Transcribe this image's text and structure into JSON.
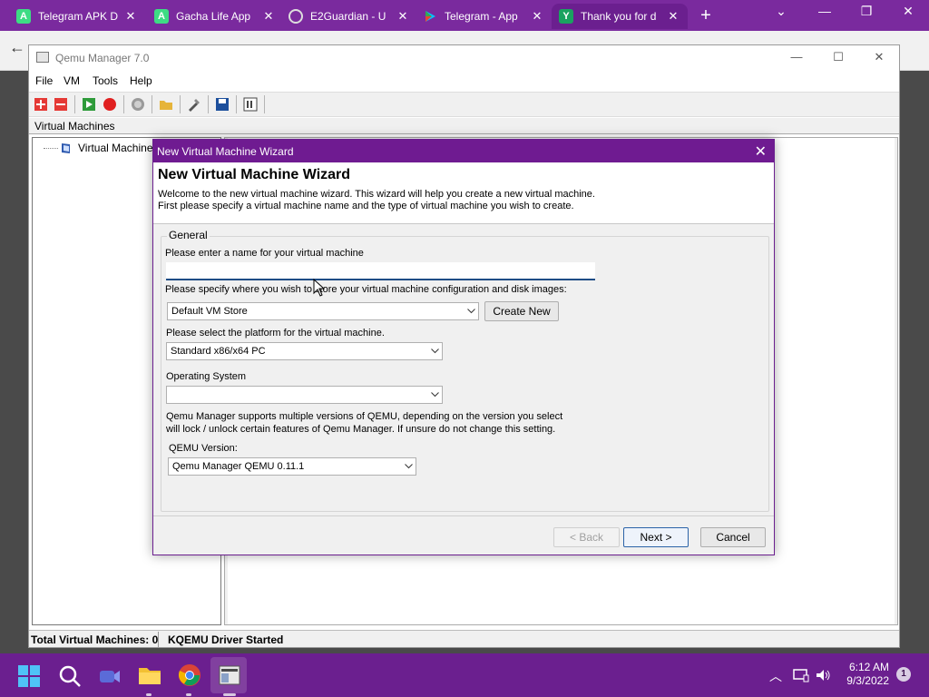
{
  "browser": {
    "tabs": [
      {
        "title": "Telegram APK D",
        "icon": "android-icon"
      },
      {
        "title": "Gacha Life App",
        "icon": "android-icon"
      },
      {
        "title": "E2Guardian - U",
        "icon": "globe-icon"
      },
      {
        "title": "Telegram - App",
        "icon": "play-store-icon"
      },
      {
        "title": "Thank you for d",
        "icon": "brand-y-icon"
      }
    ],
    "new_tab_symbol": "+",
    "tab_close_symbol": "✕"
  },
  "qemu": {
    "window_title": "Qemu Manager 7.0",
    "menu": [
      "File",
      "VM",
      "Tools",
      "Help"
    ],
    "tab_label": "Virtual Machines",
    "tree_item": "Virtual Machines",
    "status_left": "Total Virtual Machines: 0",
    "status_right": "KQEMU Driver Started"
  },
  "wizard": {
    "title_bar": "New Virtual Machine Wizard",
    "heading": "New Virtual Machine Wizard",
    "desc1": "Welcome to the new virtual machine wizard.   This wizard will help you create a new virtual machine.",
    "desc2": "First please specify a virtual machine name and the type of virtual machine you wish to create.",
    "group_label": "General",
    "name_label": "Please enter a name for your virtual machine",
    "name_value": "",
    "store_label": "Please specify where you wish to store your virtual machine configuration and disk images:",
    "store_value": "Default VM Store",
    "create_new": "Create New",
    "platform_label": "Please select the platform for the virtual machine.",
    "platform_value": "Standard x86/x64 PC",
    "os_label": "Operating System",
    "os_value": "",
    "qemu_note1": "Qemu Manager supports multiple versions of QEMU, depending on the version you select",
    "qemu_note2": "will lock / unlock certain features of Qemu Manager. If unsure do not change this setting.",
    "qemu_version_label": "QEMU Version:",
    "qemu_version_value": "Qemu Manager QEMU 0.11.1",
    "back": "< Back",
    "next": "Next >",
    "cancel": "Cancel"
  },
  "taskbar": {
    "time": "6:12 AM",
    "date": "9/3/2022",
    "notification_count": "1"
  },
  "colors": {
    "accent": "#6f1b91",
    "taskbar": "#6b1f8f"
  }
}
